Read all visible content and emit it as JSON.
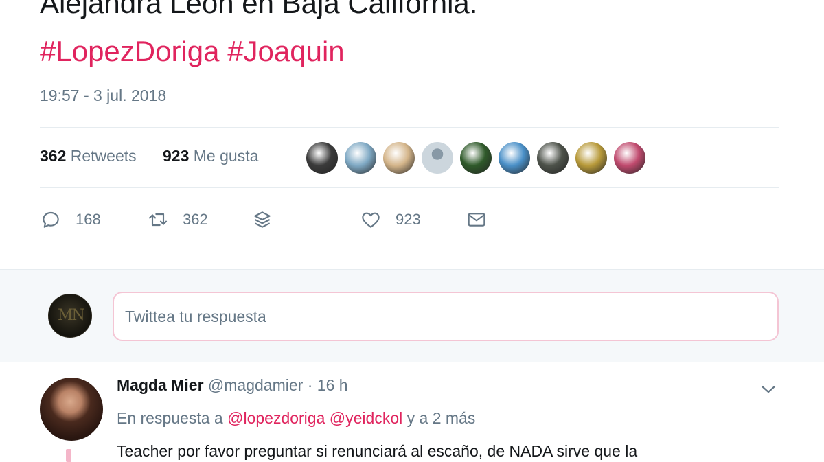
{
  "tweet": {
    "text_line1": "Alejandra León en Baja California.",
    "hashtags": [
      "#LopezDoriga",
      "#Joaquin"
    ],
    "timestamp": "19:57 - 3 jul. 2018"
  },
  "stats": {
    "retweets_count": "362",
    "retweets_label": "Retweets",
    "likes_count": "923",
    "likes_label": "Me gusta",
    "liker_avatars": [
      {
        "name": "liker-avatar-1",
        "color": "#3b3b3b"
      },
      {
        "name": "liker-avatar-2",
        "color": "#7fa9c4"
      },
      {
        "name": "liker-avatar-3",
        "color": "#d4b58a"
      },
      {
        "name": "liker-avatar-4",
        "color": "#ccd6dd"
      },
      {
        "name": "liker-avatar-5",
        "color": "#2f5a2a"
      },
      {
        "name": "liker-avatar-6",
        "color": "#4a90c8"
      },
      {
        "name": "liker-avatar-7",
        "color": "#4d524a"
      },
      {
        "name": "liker-avatar-8",
        "color": "#b89a3a"
      },
      {
        "name": "liker-avatar-9",
        "color": "#c04a6e"
      }
    ]
  },
  "actions": {
    "reply_count": "168",
    "retweet_count": "362",
    "like_count": "923",
    "icons": [
      "reply-icon",
      "retweet-icon",
      "stack-icon",
      "heart-icon",
      "mail-icon"
    ]
  },
  "reply_box": {
    "placeholder": "Twittea tu respuesta"
  },
  "reply": {
    "author_name": "Magda Mier",
    "author_handle": "@magdamier",
    "separator": " · ",
    "time": "16 h",
    "replying_prefix": "En respuesta a ",
    "mention1": "@lopezdoriga",
    "mention2": "@yeidckol",
    "replying_suffix": " y a 2 más",
    "text": "Teacher por favor preguntar si renunciará al escaño, de NADA sirve que la"
  },
  "colors": {
    "accent": "#e0245e",
    "secondary_text": "#657786",
    "divider": "#e6ecf0"
  }
}
